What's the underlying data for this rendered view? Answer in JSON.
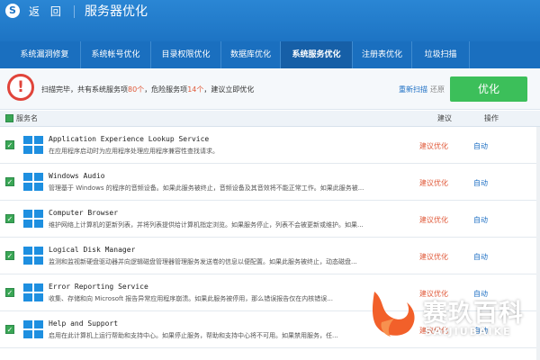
{
  "window": {
    "back_label": "返 回",
    "title": "服务器优化"
  },
  "tabs": [
    {
      "label": "系统漏洞修复"
    },
    {
      "label": "系统帐号优化"
    },
    {
      "label": "目录权限优化"
    },
    {
      "label": "数据库优化"
    },
    {
      "label": "系统服务优化"
    },
    {
      "label": "注册表优化"
    },
    {
      "label": "垃圾扫描"
    }
  ],
  "active_tab": "系统服务优化",
  "scan": {
    "alert_symbol": "!",
    "prefix": "扫描完毕，共有系统服务项",
    "total": "80个",
    "middle": "，危险服务项",
    "danger": "14个",
    "suffix": "，建议立即优化",
    "rescan_label": "重新扫描",
    "restore_label": "还原",
    "optimize_label": "优化"
  },
  "table": {
    "col_name": "服务名",
    "col_suggestion": "建议",
    "col_action": "操作"
  },
  "services": [
    {
      "name": "Application Experience Lookup Service",
      "description": "在应用程序启动时为应用程序处理应用程序兼容性查找请求。",
      "suggestion": "建议优化",
      "action": "自动"
    },
    {
      "name": "Windows Audio",
      "description": "管理基于 Windows 的程序的音频设备。如果此服务被终止，音频设备及其音效将不能正常工作。如果此服务被...",
      "suggestion": "建议优化",
      "action": "自动"
    },
    {
      "name": "Computer Browser",
      "description": "维护网络上计算机的更新列表，并将列表提供给计算机指定浏览。如果服务停止，列表不会被更新或维护。如果...",
      "suggestion": "建议优化",
      "action": "自动"
    },
    {
      "name": "Logical Disk Manager",
      "description": "监测和监视新硬盘驱动器并向逻辑磁盘管理器管理服务发送卷的信息以便配置。如果此服务被终止，动态磁盘...",
      "suggestion": "建议优化",
      "action": "自动"
    },
    {
      "name": "Error Reporting Service",
      "description": "收集、存储和向 Microsoft 报告异常应用程序崩溃。如果此服务被停用，那么错误报告仅在内核错误...",
      "suggestion": "建议优化",
      "action": "自动"
    },
    {
      "name": "Help and Support",
      "description": "启用在此计算机上运行帮助和支持中心。如果停止服务，帮助和支持中心将不可用。如果禁用服务，任...",
      "suggestion": "建议优化",
      "action": "自动"
    }
  ],
  "watermark": {
    "title": "赛玖百科",
    "subtitle": "SAIJIUBAIKE"
  },
  "colors": {
    "title_bar": "#1d74c4",
    "tab_bar": "#1a6fbf",
    "optimize_button": "#3cbf5a",
    "alert": "#e0443a",
    "highlight": "#e05a3a",
    "link": "#1d6fc4",
    "watermark_logo": "#f2602a"
  }
}
